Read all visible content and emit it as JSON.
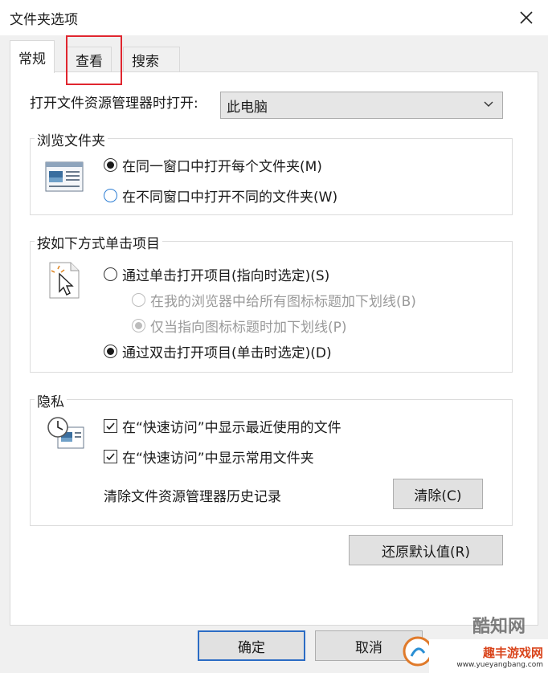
{
  "window": {
    "title": "文件夹选项"
  },
  "tabs": [
    {
      "label": "常规"
    },
    {
      "label": "查看"
    },
    {
      "label": "搜索"
    }
  ],
  "open_explorer": {
    "label": "打开文件资源管理器时打开:",
    "value": "此电脑"
  },
  "browse": {
    "title": "浏览文件夹",
    "options": [
      {
        "label": "在同一窗口中打开每个文件夹(M)",
        "checked": true
      },
      {
        "label": "在不同窗口中打开不同的文件夹(W)",
        "checked": false
      }
    ]
  },
  "click": {
    "title": "按如下方式单击项目",
    "single": {
      "label": "通过单击打开项目(指向时选定)(S)",
      "checked": false
    },
    "underline_all": {
      "label": "在我的浏览器中给所有图标标题加下划线(B)",
      "checked": false,
      "disabled": true
    },
    "underline_hover": {
      "label": "仅当指向图标标题时加下划线(P)",
      "checked": true,
      "disabled": true
    },
    "double": {
      "label": "通过双击打开项目(单击时选定)(D)",
      "checked": true
    }
  },
  "privacy": {
    "title": "隐私",
    "recent_files": {
      "label": "在“快速访问”中显示最近使用的文件",
      "checked": true
    },
    "frequent_folders": {
      "label": "在“快速访问”中显示常用文件夹",
      "checked": true
    },
    "clear_label": "清除文件资源管理器历史记录",
    "clear_button": "清除(C)"
  },
  "restore_button": "还原默认值(R)",
  "footer": {
    "ok_button": "确定",
    "cancel_button": "取消"
  },
  "watermark": {
    "brand": "酷知网",
    "site_cn": "趣丰游戏网",
    "site_url": "www.yueyangbang.com"
  },
  "colors": {
    "highlight": "#e0262f",
    "default_border": "#2b6cc4"
  }
}
